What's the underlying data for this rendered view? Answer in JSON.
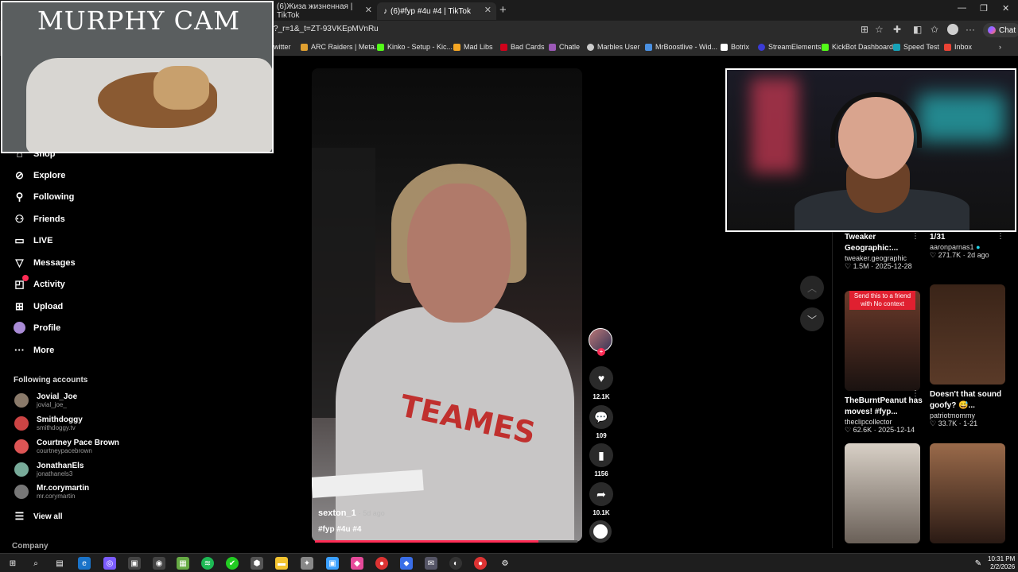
{
  "browser": {
    "tabs": [
      {
        "title": "(6)Жиза жизненная | TikTok",
        "active": false
      },
      {
        "title": "(6)#fyp #4u #4 | TikTok",
        "active": true
      }
    ],
    "url": "?_r=1&_t=ZT-93VKEpMVnRu",
    "chat_label": "Chat",
    "bookmarks": [
      {
        "label": "witter",
        "color": "#1d9bf0"
      },
      {
        "label": "ARC Raiders | Meta...",
        "color": "#e0a030"
      },
      {
        "label": "Kinko - Setup - Kic...",
        "color": "#53fc18"
      },
      {
        "label": "Mad Libs",
        "color": "#f5a623"
      },
      {
        "label": "Bad Cards",
        "color": "#d0021b"
      },
      {
        "label": "Chatle",
        "color": "#9b59b6"
      },
      {
        "label": "Marbles User",
        "color": "#cccccc"
      },
      {
        "label": "MrBoostlive - Wid...",
        "color": "#4a90e2"
      },
      {
        "label": "Botrix",
        "color": "#ffffff"
      },
      {
        "label": "StreamElements",
        "color": "#3b3bd6"
      },
      {
        "label": "KickBot Dashboard",
        "color": "#53fc18"
      },
      {
        "label": "Speed Test",
        "color": "#17a2b8"
      },
      {
        "label": "Inbox",
        "color": "#ea4335"
      }
    ]
  },
  "overlays": {
    "pet_cam_title": "MURPHY CAM"
  },
  "sidebar": {
    "items": [
      {
        "label": "Shop",
        "icon": "shop-icon"
      },
      {
        "label": "Explore",
        "icon": "compass-icon"
      },
      {
        "label": "Following",
        "icon": "user-plus-icon"
      },
      {
        "label": "Friends",
        "icon": "friends-icon"
      },
      {
        "label": "LIVE",
        "icon": "live-icon"
      },
      {
        "label": "Messages",
        "icon": "send-icon"
      },
      {
        "label": "Activity",
        "icon": "inbox-icon"
      },
      {
        "label": "Upload",
        "icon": "plus-square-icon"
      },
      {
        "label": "Profile",
        "icon": "avatar-icon"
      },
      {
        "label": "More",
        "icon": "more-icon"
      }
    ],
    "following_header": "Following accounts",
    "accounts": [
      {
        "name": "Jovial_Joe",
        "handle": "jovial_joe_"
      },
      {
        "name": "Smithdoggy",
        "handle": "smithdoggy.tv"
      },
      {
        "name": "Courtney Pace Brown",
        "handle": "courtneypacebrown"
      },
      {
        "name": "JonathanEls",
        "handle": "jonathanels3"
      },
      {
        "name": "Mr.corymartin",
        "handle": "mr.corymartin"
      }
    ],
    "view_all": "View all",
    "company": "Company"
  },
  "video": {
    "author": "sexton_1",
    "posted": "· 5d ago",
    "tags": "#fyp #4u #4",
    "shirt_text": "TEAMES",
    "progress": 0.85,
    "likes": "12.1K",
    "comments": "109",
    "saves": "1156",
    "shares": "10.1K"
  },
  "related": [
    {
      "title": "Tweaker Geographic:...",
      "author": "tweaker.geographic",
      "views": "1.5M",
      "date": "2025-12-28"
    },
    {
      "title": "1/31",
      "author": "aaronparnas1",
      "views": "271.7K",
      "date": "2d ago"
    },
    {
      "title": "TheBurntPeanut has moves! #fyp...",
      "author": "theclipcollector",
      "views": "62.6K",
      "date": "2025-12-14",
      "overlay": "Send this to a friend with No context"
    },
    {
      "title": "Doesn't that sound goofy? 😅...",
      "author": "patriotmommy",
      "views": "33.7K",
      "date": "1-21"
    }
  ],
  "taskbar": {
    "time": "10:31 PM",
    "date": "2/2/2026"
  }
}
